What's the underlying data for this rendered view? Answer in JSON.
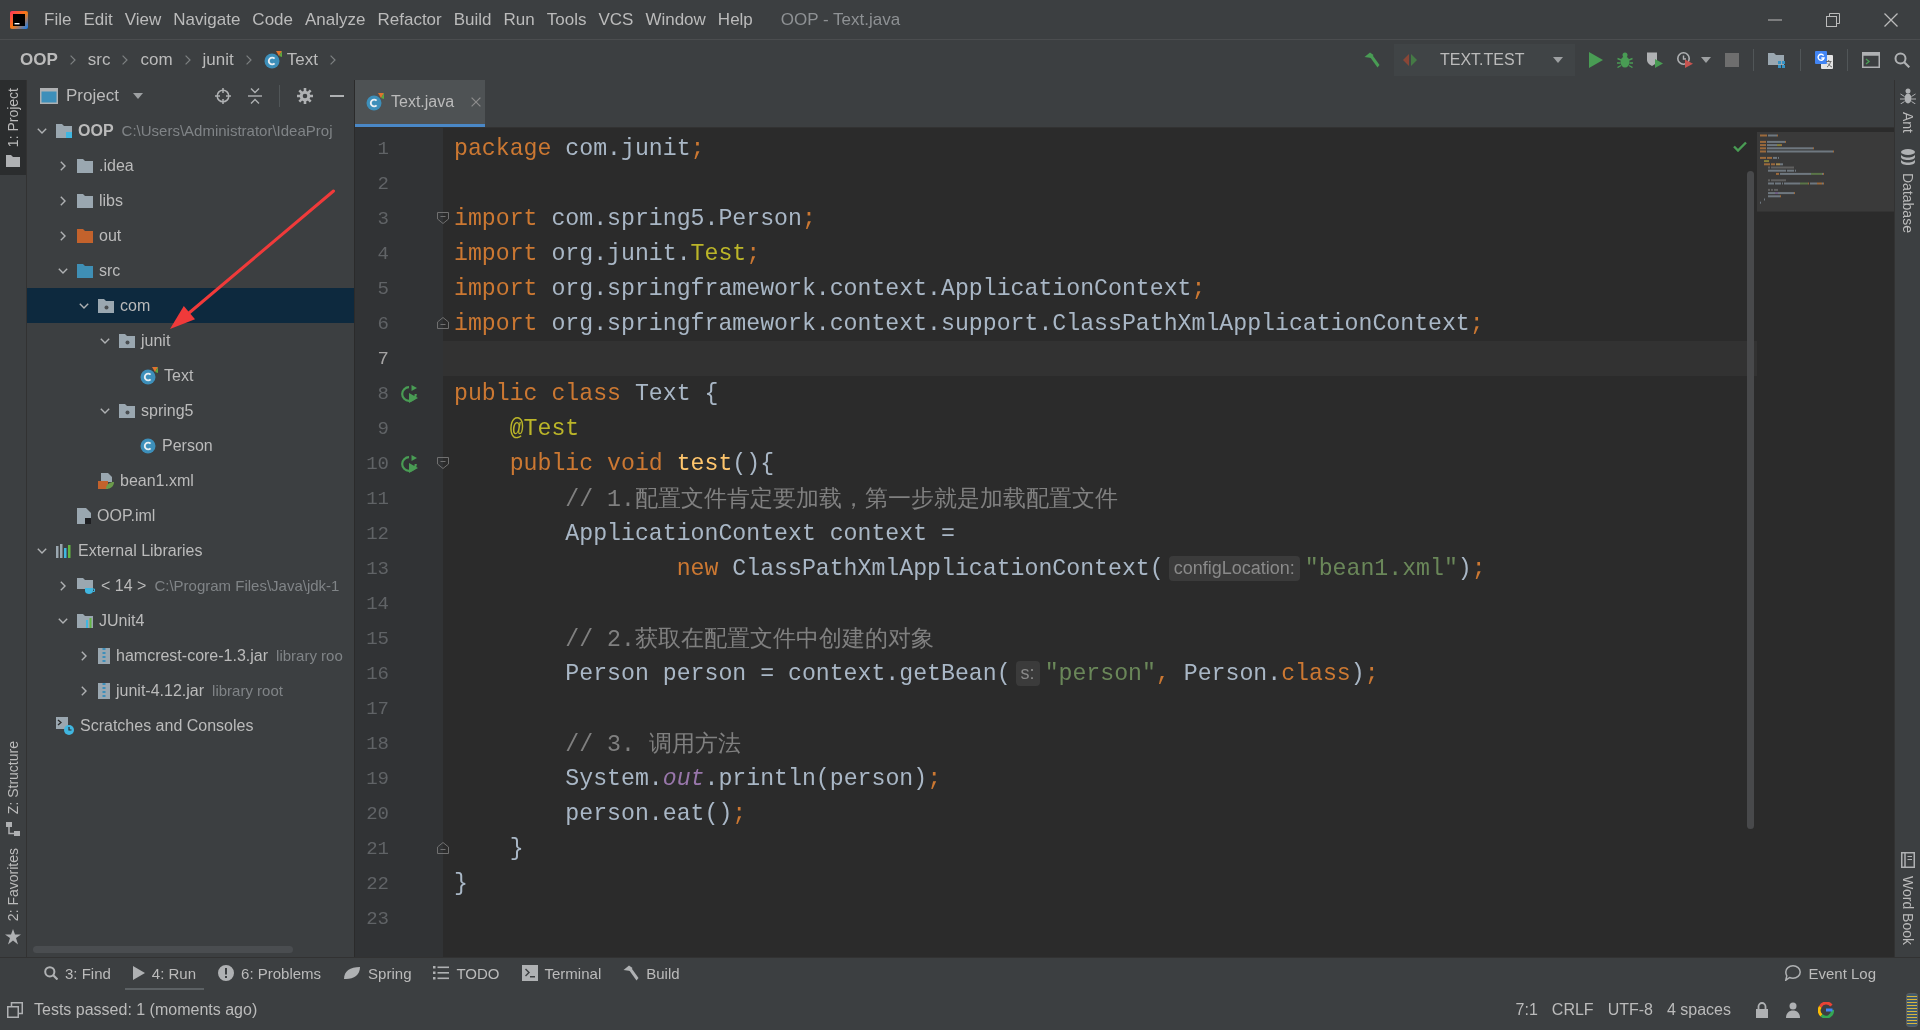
{
  "window": {
    "title": "OOP - Text.java"
  },
  "menu": [
    "File",
    "Edit",
    "View",
    "Navigate",
    "Code",
    "Analyze",
    "Refactor",
    "Build",
    "Run",
    "Tools",
    "VCS",
    "Window",
    "Help"
  ],
  "breadcrumbs": [
    {
      "label": "OOP",
      "kind": "module"
    },
    {
      "label": "src",
      "kind": "folder"
    },
    {
      "label": "com",
      "kind": "folder"
    },
    {
      "label": "junit",
      "kind": "folder"
    },
    {
      "label": "Text",
      "kind": "test-class"
    }
  ],
  "toolbar": {
    "run_configuration": "TEXT.TEST"
  },
  "left_stripe": {
    "top": [
      {
        "label": "1: Project",
        "kind": "project",
        "selected": true
      }
    ],
    "bottom": [
      {
        "label": "Z: Structure",
        "kind": "structure",
        "selected": false
      },
      {
        "label": "2: Favorites",
        "kind": "favorites",
        "selected": false
      }
    ]
  },
  "project_panel": {
    "title": "Project",
    "tree": [
      {
        "label": "OOP",
        "detail": "C:\\Users\\Administrator\\IdeaProj",
        "kind": "module",
        "expanded": true,
        "selected": false,
        "children": [
          {
            "label": ".idea",
            "kind": "folder",
            "expanded": false,
            "selected": false
          },
          {
            "label": "libs",
            "kind": "folder",
            "expanded": false,
            "selected": false
          },
          {
            "label": "out",
            "kind": "excluded-folder",
            "expanded": false,
            "selected": false
          },
          {
            "label": "src",
            "kind": "source-folder",
            "expanded": true,
            "selected": false,
            "children": [
              {
                "label": "com",
                "kind": "package",
                "expanded": true,
                "selected": true,
                "children": [
                  {
                    "label": "junit",
                    "kind": "package",
                    "expanded": true,
                    "selected": false,
                    "children": [
                      {
                        "label": "Text",
                        "kind": "test-class",
                        "selected": false
                      }
                    ]
                  },
                  {
                    "label": "spring5",
                    "kind": "package",
                    "expanded": true,
                    "selected": false,
                    "children": [
                      {
                        "label": "Person",
                        "kind": "class",
                        "selected": false
                      }
                    ]
                  }
                ]
              },
              {
                "label": "bean1.xml",
                "kind": "spring-xml",
                "selected": false
              }
            ]
          },
          {
            "label": "OOP.iml",
            "kind": "module-file",
            "selected": false
          }
        ]
      },
      {
        "label": "External Libraries",
        "kind": "libraries",
        "expanded": true,
        "selected": false,
        "children": [
          {
            "label": "< 14 >",
            "detail": "C:\\Program Files\\Java\\jdk-1",
            "kind": "jdk",
            "expanded": false,
            "selected": false
          },
          {
            "label": "JUnit4",
            "kind": "library",
            "expanded": true,
            "selected": false,
            "children": [
              {
                "label": "hamcrest-core-1.3.jar",
                "detail": "library roo",
                "kind": "jar",
                "expanded": false,
                "selected": false
              },
              {
                "label": "junit-4.12.jar",
                "detail": "library root",
                "kind": "jar",
                "expanded": false,
                "selected": false
              }
            ]
          }
        ]
      },
      {
        "label": "Scratches and Consoles",
        "kind": "scratches",
        "selected": false
      }
    ]
  },
  "editor": {
    "tabs": [
      {
        "label": "Text.java",
        "selected": true
      }
    ],
    "lines": [
      {
        "number": "1",
        "current": false,
        "tokens": [
          {
            "text": "package",
            "kind": "keyword"
          },
          {
            "text": " com.junit",
            "kind": "plain"
          },
          {
            "text": ";",
            "kind": "keyword"
          }
        ]
      },
      {
        "number": "2",
        "current": false
      },
      {
        "number": "3",
        "current": false,
        "markers": [
          {
            "kind": "fold-start"
          }
        ],
        "tokens": [
          {
            "text": "import",
            "kind": "keyword"
          },
          {
            "text": " com.spring5.Person",
            "kind": "plain"
          },
          {
            "text": ";",
            "kind": "keyword"
          }
        ]
      },
      {
        "number": "4",
        "current": false,
        "tokens": [
          {
            "text": "import",
            "kind": "keyword"
          },
          {
            "text": " org.junit.",
            "kind": "plain"
          },
          {
            "text": "Test",
            "kind": "annotation"
          },
          {
            "text": ";",
            "kind": "keyword"
          }
        ]
      },
      {
        "number": "5",
        "current": false,
        "tokens": [
          {
            "text": "import",
            "kind": "keyword"
          },
          {
            "text": " org.springframework.context.ApplicationContext",
            "kind": "plain"
          },
          {
            "text": ";",
            "kind": "keyword"
          }
        ]
      },
      {
        "number": "6",
        "current": false,
        "markers": [
          {
            "kind": "fold-end"
          }
        ],
        "tokens": [
          {
            "text": "import",
            "kind": "keyword"
          },
          {
            "text": " org.springframework.context.support.ClassPathXmlApplicationContext",
            "kind": "plain"
          },
          {
            "text": ";",
            "kind": "keyword"
          }
        ]
      },
      {
        "number": "7",
        "current": true
      },
      {
        "number": "8",
        "current": false,
        "markers": [
          {
            "kind": "run"
          }
        ],
        "tokens": [
          {
            "text": "public class",
            "kind": "keyword"
          },
          {
            "text": " Text {",
            "kind": "plain"
          }
        ]
      },
      {
        "number": "9",
        "current": false,
        "tokens": [
          {
            "text": "    @Test",
            "kind": "annotation"
          }
        ]
      },
      {
        "number": "10",
        "current": false,
        "markers": [
          {
            "kind": "run"
          },
          {
            "kind": "fold-start"
          }
        ],
        "tokens": [
          {
            "text": "    public void",
            "kind": "keyword"
          },
          {
            "text": " test",
            "kind": "method"
          },
          {
            "text": "(){",
            "kind": "plain"
          }
        ]
      },
      {
        "number": "11",
        "current": false,
        "tokens": [
          {
            "text": "        // 1.配置文件肯定要加载，第一步就是加载配置文件",
            "kind": "comment"
          }
        ]
      },
      {
        "number": "12",
        "current": false,
        "tokens": [
          {
            "text": "        ApplicationContext context =",
            "kind": "plain"
          }
        ]
      },
      {
        "number": "13",
        "current": false,
        "tokens": [
          {
            "text": "                new",
            "kind": "keyword"
          },
          {
            "text": " ClassPathXmlApplicationContext(",
            "kind": "plain"
          },
          {
            "text": "configLocation:",
            "kind": "hint"
          },
          {
            "text": "\"bean1.xml\"",
            "kind": "string"
          },
          {
            "text": ")",
            "kind": "plain"
          },
          {
            "text": ";",
            "kind": "keyword"
          }
        ]
      },
      {
        "number": "14",
        "current": false
      },
      {
        "number": "15",
        "current": false,
        "tokens": [
          {
            "text": "        // 2.获取在配置文件中创建的对象",
            "kind": "comment"
          }
        ]
      },
      {
        "number": "16",
        "current": false,
        "tokens": [
          {
            "text": "        Person person = context.getBean(",
            "kind": "plain"
          },
          {
            "text": "s:",
            "kind": "hint"
          },
          {
            "text": "\"person\"",
            "kind": "string"
          },
          {
            "text": ",",
            "kind": "keyword"
          },
          {
            "text": " Person.",
            "kind": "plain"
          },
          {
            "text": "class",
            "kind": "keyword"
          },
          {
            "text": ")",
            "kind": "plain"
          },
          {
            "text": ";",
            "kind": "keyword"
          }
        ]
      },
      {
        "number": "17",
        "current": false
      },
      {
        "number": "18",
        "current": false,
        "tokens": [
          {
            "text": "        // 3. 调用方法",
            "kind": "comment"
          }
        ]
      },
      {
        "number": "19",
        "current": false,
        "tokens": [
          {
            "text": "        System.",
            "kind": "plain"
          },
          {
            "text": "out",
            "kind": "field"
          },
          {
            "text": ".println(person)",
            "kind": "plain"
          },
          {
            "text": ";",
            "kind": "keyword"
          }
        ]
      },
      {
        "number": "20",
        "current": false,
        "tokens": [
          {
            "text": "        person.eat()",
            "kind": "plain"
          },
          {
            "text": ";",
            "kind": "keyword"
          }
        ]
      },
      {
        "number": "21",
        "current": false,
        "markers": [
          {
            "kind": "fold-end"
          }
        ],
        "tokens": [
          {
            "text": "    }",
            "kind": "plain"
          }
        ]
      },
      {
        "number": "22",
        "current": false,
        "tokens": [
          {
            "text": "}",
            "kind": "plain"
          }
        ]
      },
      {
        "number": "23",
        "current": false
      }
    ]
  },
  "right_stripe": {
    "top": [
      {
        "label": "Ant",
        "kind": "ant",
        "selected": false
      },
      {
        "label": "Database",
        "kind": "database",
        "selected": false
      }
    ],
    "bottom": [
      {
        "label": "Word Book",
        "kind": "word-book",
        "selected": false
      }
    ]
  },
  "bottom_toolbar": {
    "left": [
      {
        "label": "3: Find",
        "kind": "find",
        "selected": false
      },
      {
        "label": "4: Run",
        "kind": "run",
        "selected": true
      },
      {
        "label": "6: Problems",
        "kind": "problems",
        "selected": false
      },
      {
        "label": "Spring",
        "kind": "spring",
        "selected": false
      },
      {
        "label": "TODO",
        "kind": "todo",
        "selected": false
      },
      {
        "label": "Terminal",
        "kind": "terminal",
        "selected": false
      },
      {
        "label": "Build",
        "kind": "build",
        "selected": false
      }
    ],
    "right": [
      {
        "label": "Event Log",
        "kind": "event-log",
        "selected": false
      }
    ]
  },
  "status_bar": {
    "message": "Tests passed: 1 (moments ago)",
    "items": [
      "7:1",
      "CRLF",
      "UTF-8",
      "4 spaces"
    ]
  },
  "annotations": [
    {
      "kind": "arrow"
    }
  ]
}
